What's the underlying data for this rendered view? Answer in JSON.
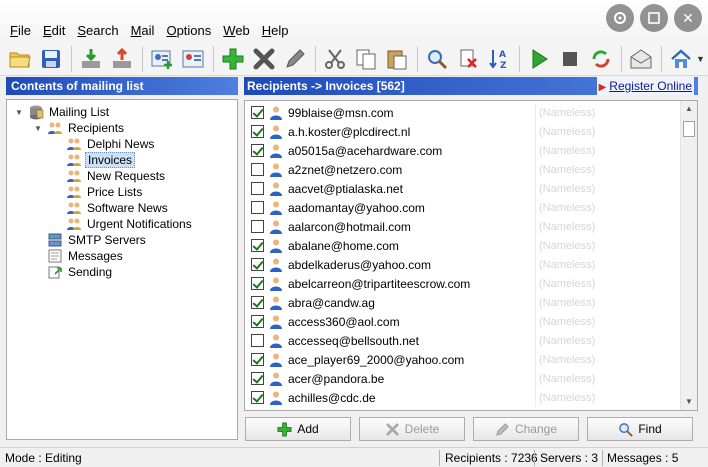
{
  "menu": [
    "File",
    "Edit",
    "Search",
    "Mail",
    "Options",
    "Web",
    "Help"
  ],
  "toolbar_icons": [
    "open-folder-icon",
    "save-icon",
    "import-icon",
    "export-icon",
    "add-contact-icon",
    "contact-card-icon",
    "add-icon",
    "delete-x-icon",
    "edit-pencil-icon",
    "cut-icon",
    "copy-icon",
    "paste-icon",
    "search-icon",
    "clean-icon",
    "sort-az-icon",
    "play-icon",
    "stop-icon",
    "refresh-icon",
    "mail-send-icon",
    "home-icon"
  ],
  "left_panel": {
    "title": "Contents of mailing list",
    "tree": [
      {
        "label": "Mailing List",
        "icon": "database-icon",
        "level": 0,
        "expander": "▼"
      },
      {
        "label": "Recipients",
        "icon": "people-icon",
        "level": 1,
        "expander": "▼"
      },
      {
        "label": "Delphi News",
        "icon": "people-icon",
        "level": 2,
        "expander": ""
      },
      {
        "label": "Invoices",
        "icon": "people-icon",
        "level": 2,
        "expander": "",
        "selected": true
      },
      {
        "label": "New Requests",
        "icon": "people-icon",
        "level": 2,
        "expander": ""
      },
      {
        "label": "Price Lists",
        "icon": "people-icon",
        "level": 2,
        "expander": ""
      },
      {
        "label": "Software News",
        "icon": "people-icon",
        "level": 2,
        "expander": ""
      },
      {
        "label": "Urgent Notifications",
        "icon": "people-icon",
        "level": 2,
        "expander": ""
      },
      {
        "label": "SMTP Servers",
        "icon": "server-icon",
        "level": 1,
        "expander": ""
      },
      {
        "label": "Messages",
        "icon": "messages-icon",
        "level": 1,
        "expander": ""
      },
      {
        "label": "Sending",
        "icon": "sending-icon",
        "level": 1,
        "expander": ""
      }
    ]
  },
  "right_panel": {
    "title": "Recipients -> Invoices [562]",
    "register_label": "Register Online",
    "recipients": [
      {
        "email": "99blaise@msn.com",
        "name": "(Nameless)",
        "checked": true
      },
      {
        "email": "a.h.koster@plcdirect.nl",
        "name": "(Nameless)",
        "checked": true
      },
      {
        "email": "a05015a@acehardware.com",
        "name": "(Nameless)",
        "checked": true
      },
      {
        "email": "a2znet@netzero.com",
        "name": "(Nameless)",
        "checked": false
      },
      {
        "email": "aacvet@ptialaska.net",
        "name": "(Nameless)",
        "checked": false
      },
      {
        "email": "aadomantay@yahoo.com",
        "name": "(Nameless)",
        "checked": false
      },
      {
        "email": "aalarcon@hotmail.com",
        "name": "(Nameless)",
        "checked": false
      },
      {
        "email": "abalane@home.com",
        "name": "(Nameless)",
        "checked": true
      },
      {
        "email": "abdelkaderus@yahoo.com",
        "name": "(Nameless)",
        "checked": true
      },
      {
        "email": "abelcarreon@tripartiteescrow.com",
        "name": "(Nameless)",
        "checked": true
      },
      {
        "email": "abra@candw.ag",
        "name": "(Nameless)",
        "checked": true
      },
      {
        "email": "access360@aol.com",
        "name": "(Nameless)",
        "checked": true
      },
      {
        "email": "accesseq@bellsouth.net",
        "name": "(Nameless)",
        "checked": false
      },
      {
        "email": "ace_player69_2000@yahoo.com",
        "name": "(Nameless)",
        "checked": true
      },
      {
        "email": "acer@pandora.be",
        "name": "(Nameless)",
        "checked": true
      },
      {
        "email": "achilles@cdc.de",
        "name": "(Nameless)",
        "checked": true
      }
    ]
  },
  "buttons": {
    "add": "Add",
    "delete": "Delete",
    "change": "Change",
    "find": "Find"
  },
  "status": {
    "mode": "Mode :  Editing",
    "recipients": "Recipients :   7236",
    "servers": "Servers :   3",
    "messages": "Messages :   5"
  }
}
